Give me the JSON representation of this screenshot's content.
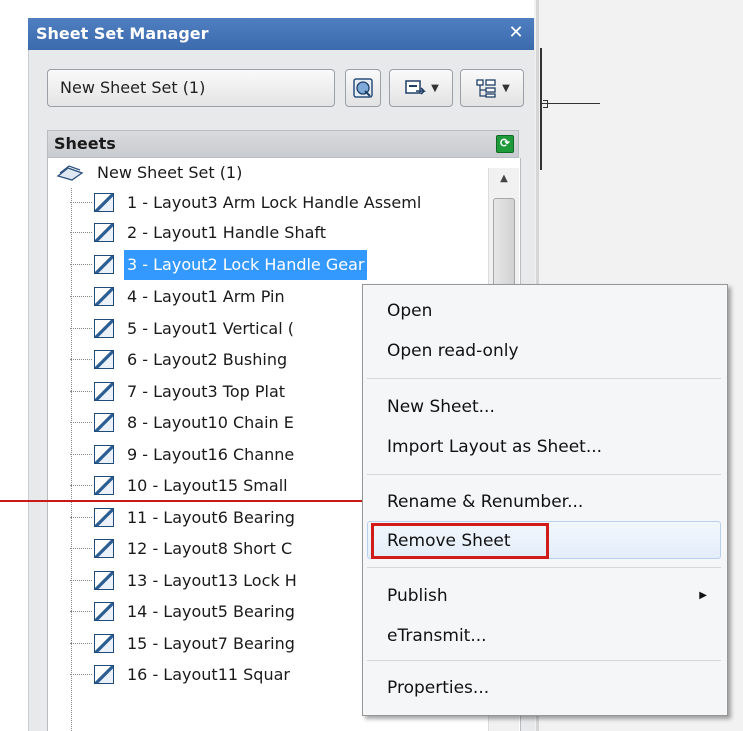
{
  "window": {
    "title": "Sheet Set Manager",
    "close_glyph": "✕"
  },
  "sheet_set_selector": {
    "value": "New Sheet Set (1)"
  },
  "toolbar": {
    "icons": [
      "publish-icon",
      "publish-dropdown-icon",
      "view-options-icon"
    ]
  },
  "sheets_section": {
    "header": "Sheets",
    "root": "New Sheet Set (1)",
    "items": [
      "1 - Layout3 Arm Lock Handle Asseml",
      "2 - Layout1 Handle Shaft",
      "3 - Layout2 Lock Handle Gear",
      "4 - Layout1 Arm Pin",
      "5 - Layout1 Vertical (",
      "6 - Layout2 Bushing",
      "7 - Layout3 Top Plat",
      "8 - Layout10 Chain E",
      "9 - Layout16 Channe",
      "10 - Layout15 Small",
      "11 - Layout6 Bearing",
      "12 - Layout8 Short C",
      "13 - Layout13 Lock H",
      "14 - Layout5 Bearing",
      "15 - Layout7 Bearing",
      "16 - Layout11 Squar"
    ],
    "selected_index": 2
  },
  "context_menu": {
    "open": "Open",
    "open_read_only": "Open read-only",
    "new_sheet": "New Sheet...",
    "import_layout": "Import Layout as Sheet...",
    "rename_renumber": "Rename & Renumber...",
    "remove_sheet": "Remove Sheet",
    "publish": "Publish",
    "etransmit": "eTransmit...",
    "properties": "Properties..."
  },
  "colors": {
    "title_bar": "#3b6aad",
    "selection": "#3399ff",
    "highlight_box": "#d11a1a",
    "annotation_line": "#c91919"
  }
}
